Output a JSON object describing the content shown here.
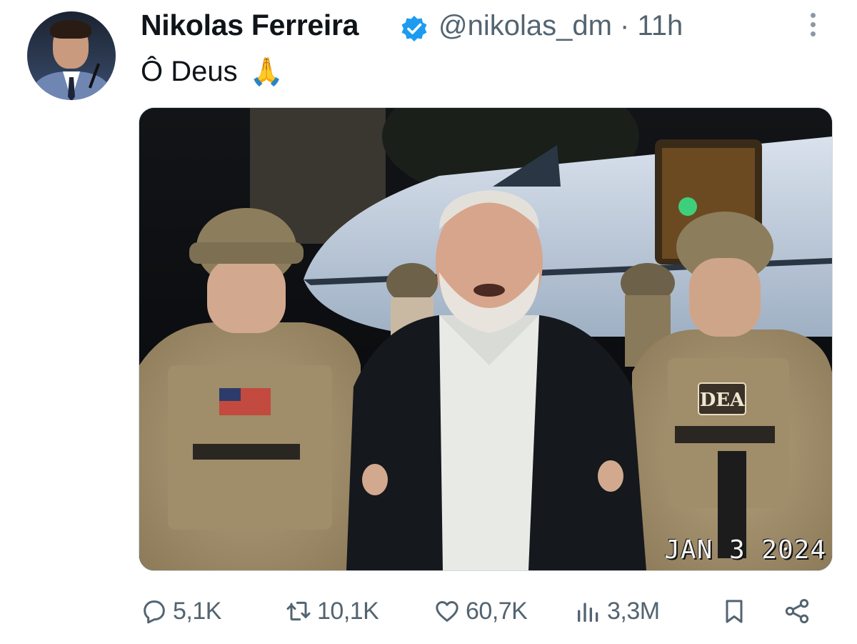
{
  "tweet": {
    "author_name": "Nikolas Ferreira",
    "handle_time": "@nikolas_dm · 11h",
    "text": "Ô Deus",
    "emoji": "🙏",
    "media_stamp": "JAN  3 2024",
    "media_badge": "DEA"
  },
  "actions": {
    "replies": "5,1K",
    "reposts": "10,1K",
    "likes": "60,7K",
    "views": "3,3M"
  },
  "colors": {
    "verified": "#1d9bf0",
    "muted": "#536471"
  }
}
